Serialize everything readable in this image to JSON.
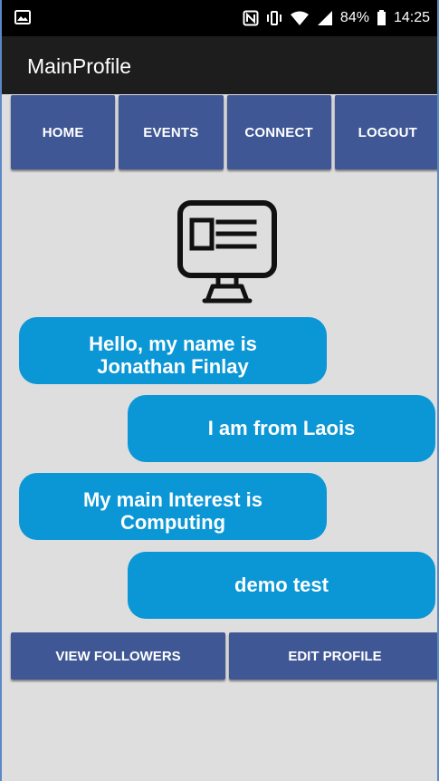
{
  "status_bar": {
    "battery_percent": "84%",
    "time": "14:25",
    "icons": [
      "image-icon",
      "nfc-icon",
      "vibrate-icon",
      "wifi-icon",
      "signal-icon",
      "battery-icon"
    ]
  },
  "app_bar": {
    "title": "MainProfile"
  },
  "nav": {
    "items": [
      "HOME",
      "EVENTS",
      "CONNECT",
      "LOGOUT"
    ]
  },
  "profile": {
    "icon": "monitor-profile-icon",
    "bubbles": [
      "Hello, my name is\nJonathan Finlay",
      "I am from Laois",
      "My main Interest is\nComputing",
      "demo test"
    ]
  },
  "actions": {
    "view_followers_label": "VIEW FOLLOWERS",
    "edit_profile_label": "EDIT PROFILE"
  },
  "colors": {
    "status_bar": "#000000",
    "app_bar": "#1d1d1d",
    "nav_button": "#3f5795",
    "bubble": "#0b96d6",
    "page_background": "#dedede",
    "frame_border": "#5c89c6"
  }
}
